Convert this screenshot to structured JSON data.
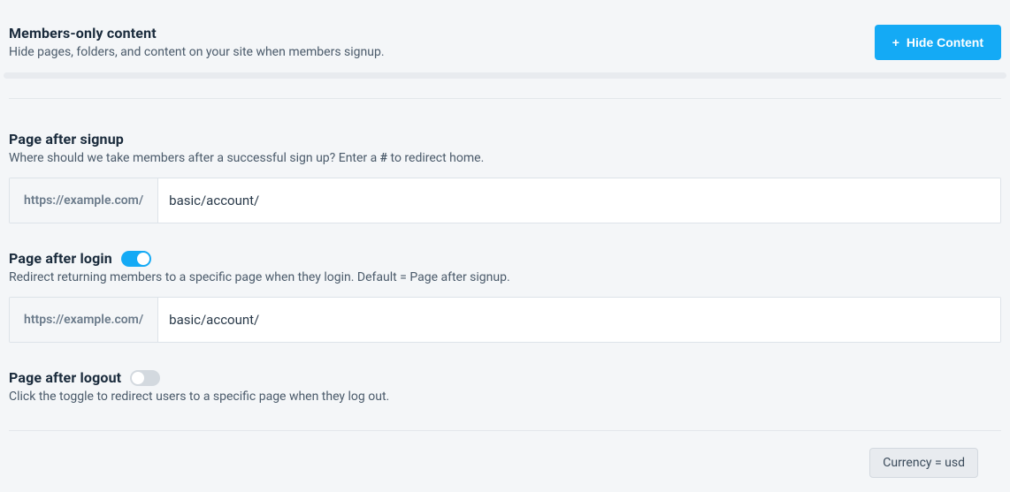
{
  "membersOnly": {
    "title": "Members-only content",
    "desc": "Hide pages, folders, and content on your site when members signup.",
    "button": "Hide Content"
  },
  "signup": {
    "title": "Page after signup",
    "descPrefix": "Where should we take members after a successful sign up? Enter a ",
    "descHash": "#",
    "descSuffix": " to redirect home.",
    "prefix": "https://example.com/",
    "value": "basic/account/"
  },
  "login": {
    "title": "Page after login",
    "desc": "Redirect returning members to a specific page when they login. Default = Page after signup.",
    "prefix": "https://example.com/",
    "value": "basic/account/",
    "toggleOn": true
  },
  "logout": {
    "title": "Page after logout",
    "desc": "Click the toggle to redirect users to a specific page when they log out.",
    "toggleOn": false
  },
  "currency": {
    "label": "Currency = usd"
  }
}
